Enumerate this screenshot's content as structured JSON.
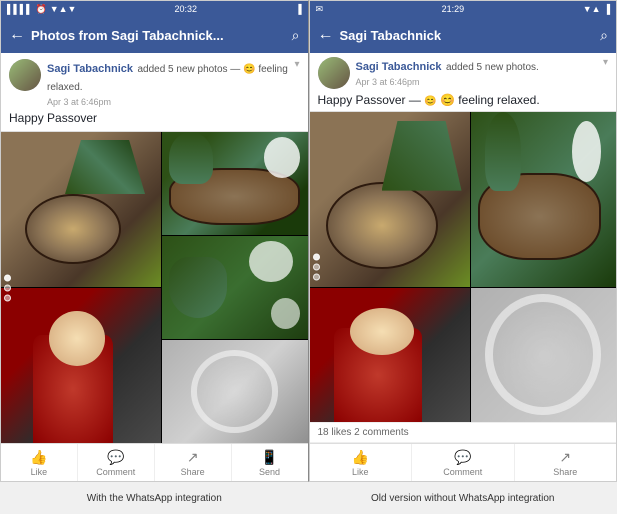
{
  "left_panel": {
    "status_bar": {
      "left": "▌▌▌▌ ⚿ ▼▲▼",
      "time": "20:32",
      "right": "🔋"
    },
    "nav": {
      "back_label": "←",
      "title": "Photos from Sagi Tabachnick...",
      "search_label": "⌕"
    },
    "post": {
      "author": "Sagi Tabachnick",
      "action": "added 5 new photos — 😊 feeling relaxed.",
      "time": "Apr 3 at 6:46pm",
      "text": "Happy Passover"
    },
    "actions": [
      {
        "icon": "👍",
        "label": "Like"
      },
      {
        "icon": "💬",
        "label": "Comment"
      },
      {
        "icon": "↗",
        "label": "Share"
      },
      {
        "icon": "📱",
        "label": "Send"
      }
    ]
  },
  "right_panel": {
    "status_bar": {
      "left": "✉ ⚡",
      "time": "21:29",
      "right": "🔋 ▼▲"
    },
    "nav": {
      "back_label": "←",
      "title": "Sagi Tabachnick",
      "search_label": "⌕"
    },
    "post": {
      "author": "Sagi Tabachnick",
      "action": "added 5 new photos.",
      "time": "Apr 3 at 6:46pm",
      "text": "Happy Passover —",
      "text2": "😊 feeling relaxed."
    },
    "likes": "18 likes  2 comments",
    "actions": [
      {
        "icon": "👍",
        "label": "Like"
      },
      {
        "icon": "💬",
        "label": "Comment"
      },
      {
        "icon": "↗",
        "label": "Share"
      }
    ]
  },
  "captions": {
    "left": "With the WhatsApp integration",
    "right": "Old version without WhatsApp integration"
  }
}
